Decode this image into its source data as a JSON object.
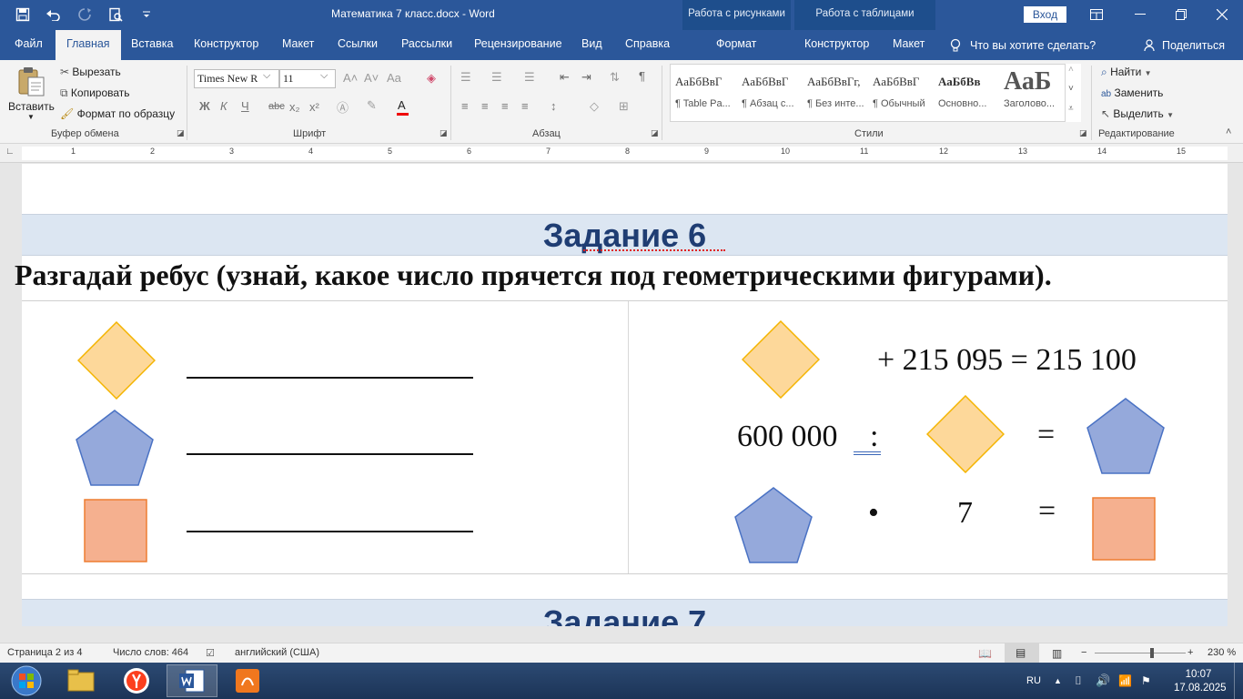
{
  "window": {
    "doc_title": "Математика 7 класс.docx  -  Word",
    "context_tab_pictures": "Работа с рисунками",
    "context_tab_tables": "Работа с таблицами",
    "signin_label": "Вход"
  },
  "ribbon_tabs": [
    "Файл",
    "Главная",
    "Вставка",
    "Конструктор",
    "Макет",
    "Ссылки",
    "Рассылки",
    "Рецензирование",
    "Вид",
    "Справка",
    "Формат",
    "Конструктор",
    "Макет"
  ],
  "tell_me": "Что вы хотите сделать?",
  "share_label": "Поделиться",
  "clipboard": {
    "paste": "Вставить",
    "cut": "Вырезать",
    "copy": "Копировать",
    "format_painter": "Формат по образцу",
    "group_label": "Буфер обмена"
  },
  "font": {
    "name": "Times New R",
    "size": "11",
    "group_label": "Шрифт",
    "bold": "Ж",
    "italic": "К",
    "underline": "Ч",
    "strike": "abc",
    "sub": "x₂",
    "sup": "x²"
  },
  "paragraph": {
    "group_label": "Абзац"
  },
  "styles": {
    "group_label": "Стили",
    "items": [
      {
        "sample": "АаБбВвГ",
        "name": "¶ Table Pa..."
      },
      {
        "sample": "АаБбВвГ",
        "name": "¶ Абзац с..."
      },
      {
        "sample": "АаБбВвГг,",
        "name": "¶ Без инте..."
      },
      {
        "sample": "АаБбВвГ",
        "name": "¶ Обычный"
      },
      {
        "sample": "АаБбВв",
        "name": "Основно..."
      },
      {
        "sample": "АаБ",
        "name": "Заголово..."
      }
    ]
  },
  "editing": {
    "group_label": "Редактирование",
    "find": "Найти",
    "replace": "Заменить",
    "select": "Выделить"
  },
  "ruler_numbers": [
    "1",
    "2",
    "3",
    "4",
    "5",
    "6",
    "7",
    "8",
    "9",
    "10",
    "11",
    "12",
    "13",
    "14",
    "15"
  ],
  "document": {
    "task6_title": "Задание 6",
    "rebus_text": "Разгадай ребус (узнай, какое число прячется под геометрическими фигурами).",
    "eq1_rest": "+   215 095 = 215 100",
    "eq2_left": "600 000",
    "eq2_op": ":",
    "eq2_eq": "=",
    "eq3_op": "•",
    "eq3_num": "7",
    "eq3_eq": "=",
    "task7_title": "Задание 7",
    "colors": {
      "diamond_fill": "#fdd89a",
      "diamond_stroke": "#f4b400",
      "pentagon_fill": "#95a9db",
      "pentagon_stroke": "#4a72c4",
      "square_fill": "#f5b08f",
      "square_stroke": "#ee7d31"
    }
  },
  "statusbar": {
    "page": "Страница 2 из 4",
    "words": "Число слов: 464",
    "language": "английский (США)",
    "zoom": "230 %"
  },
  "taskbar": {
    "lang": "RU",
    "time": "10:07",
    "date": "17.08.2025"
  }
}
